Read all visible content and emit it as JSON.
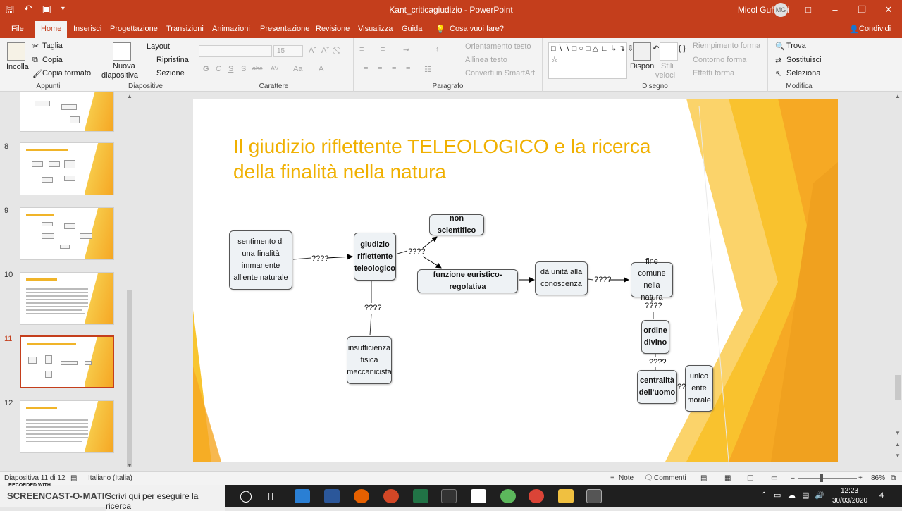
{
  "window": {
    "title": "Kant_criticagiudizio  -  PowerPoint",
    "user": "Micol Guffanti",
    "user_initials": "MG"
  },
  "menu": {
    "file": "File",
    "home": "Home",
    "insert": "Inserisci",
    "design": "Progettazione",
    "transitions": "Transizioni",
    "animations": "Animazioni",
    "slideshow": "Presentazione",
    "review": "Revisione",
    "view": "Visualizza",
    "help": "Guida",
    "tell_me": "Cosa vuoi fare?",
    "share": "Condividi"
  },
  "ribbon": {
    "clipboard": {
      "paste": "Incolla",
      "cut": "Taglia",
      "copy": "Copia",
      "format_painter": "Copia formato",
      "label": "Appunti"
    },
    "slides": {
      "new_slide_1": "Nuova",
      "new_slide_2": "diapositiva",
      "layout": "Layout",
      "reset": "Ripristina",
      "section": "Sezione",
      "label": "Diapositive"
    },
    "font": {
      "size": "15",
      "bold": "G",
      "italic": "C",
      "underline": "S",
      "shadow": "S",
      "strike": "abc",
      "spacing": "AV",
      "case": "Aa",
      "color": "A",
      "label": "Carattere"
    },
    "paragraph": {
      "text_direction": "Orientamento testo",
      "align_text": "Allinea testo",
      "smartart": "Converti in SmartArt",
      "label": "Paragrafo"
    },
    "drawing": {
      "arrange": "Disponi",
      "styles_1": "Stili",
      "styles_2": "veloci",
      "fill": "Riempimento forma",
      "outline": "Contorno forma",
      "effects": "Effetti forma",
      "label": "Disegno"
    },
    "editing": {
      "find": "Trova",
      "replace": "Sostituisci",
      "select": "Seleziona",
      "label": "Modifica"
    }
  },
  "thumbnails": [
    {
      "num": "8"
    },
    {
      "num": "9"
    },
    {
      "num": "10"
    },
    {
      "num": "11"
    },
    {
      "num": "12"
    }
  ],
  "slide": {
    "title": "Il giudizio riflettente TELEOLOGICO e la ricerca della finalità nella natura",
    "nodes": {
      "sentimento": "sentimento di una finalità immanente all'ente naturale",
      "giudizio": "giudizio riflettente teleologico",
      "non_scientifico": "non scientifico",
      "funzione": "funzione euristico-regolativa",
      "unita": "dà unità alla conoscenza",
      "fine_comune": "fine comune nella natura",
      "ordine": "ordine divino",
      "centralita": "centralità dell'uomo",
      "unico": "unico ente morale",
      "insufficienza": "insufficienza fisica meccanicista"
    },
    "q": "????",
    "q2": "??"
  },
  "status": {
    "slide_of": "Diapositiva 11 di 12",
    "language": "Italiano (Italia)",
    "notes": "Note",
    "comments": "Commenti",
    "zoom": "86%"
  },
  "taskbar": {
    "search": "Scrivi qui per eseguire la ricerca",
    "watermark": "SCREENCAST-O-MATIC",
    "recorded": "RECORDED WITH",
    "time": "12:23",
    "date": "30/03/2020",
    "notif": "4"
  }
}
